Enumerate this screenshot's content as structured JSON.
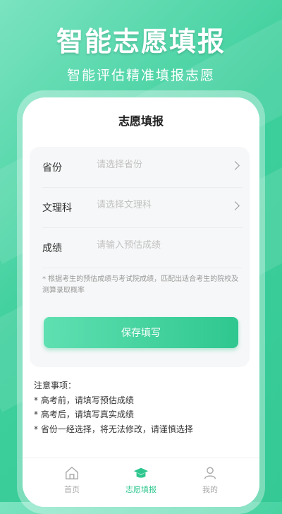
{
  "hero": {
    "title": "智能志愿填报",
    "subtitle": "智能评估精准填报志愿"
  },
  "screen": {
    "title": "志愿填报"
  },
  "form": {
    "rows": [
      {
        "label": "省份",
        "placeholder": "请选择省份",
        "has_chevron": true
      },
      {
        "label": "文理科",
        "placeholder": "请选择文理科",
        "has_chevron": true
      },
      {
        "label": "成绩",
        "placeholder": "请输入预估成绩",
        "has_chevron": false
      }
    ],
    "note": "* 根据考生的预估成绩与考试院成绩，匹配出适合考生的院校及测算录取概率",
    "save_label": "保存填写"
  },
  "notice": {
    "heading": "注意事项：",
    "items": [
      "* 高考前，请填写预估成绩",
      "* 高考后，请填写真实成绩",
      "* 省份一经选择，将无法修改，请谨慎选择"
    ]
  },
  "tabbar": {
    "items": [
      {
        "label": "首页",
        "icon": "home-icon",
        "active": false
      },
      {
        "label": "志愿填报",
        "icon": "graduation-cap-icon",
        "active": true
      },
      {
        "label": "我的",
        "icon": "user-icon",
        "active": false
      }
    ]
  },
  "colors": {
    "accent": "#2fc78f",
    "background": "#3dcf9c"
  }
}
